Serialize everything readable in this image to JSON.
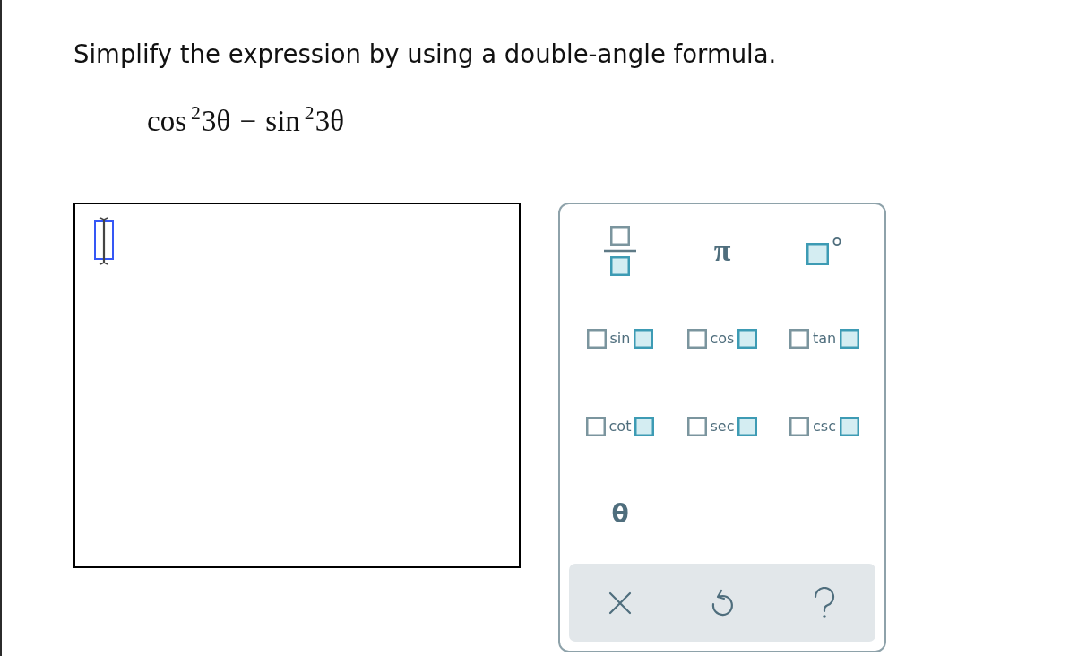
{
  "question": {
    "prompt": "Simplify the expression by using a double-angle formula.",
    "expression": "cos$^{2}$3θ − sin$^{2}$3θ"
  },
  "answer_box": {
    "focused": true
  },
  "keypad": {
    "keys": [
      {
        "kind": "fraction"
      },
      {
        "kind": "symbol",
        "label": "π"
      },
      {
        "kind": "degree"
      },
      {
        "kind": "function",
        "label": "sin"
      },
      {
        "kind": "function",
        "label": "cos"
      },
      {
        "kind": "function",
        "label": "tan"
      },
      {
        "kind": "function",
        "label": "cot"
      },
      {
        "kind": "function",
        "label": "sec"
      },
      {
        "kind": "function",
        "label": "csc"
      },
      {
        "kind": "variable",
        "label": "θ"
      }
    ],
    "actions": [
      {
        "kind": "clear"
      },
      {
        "kind": "undo"
      },
      {
        "kind": "help"
      }
    ]
  }
}
